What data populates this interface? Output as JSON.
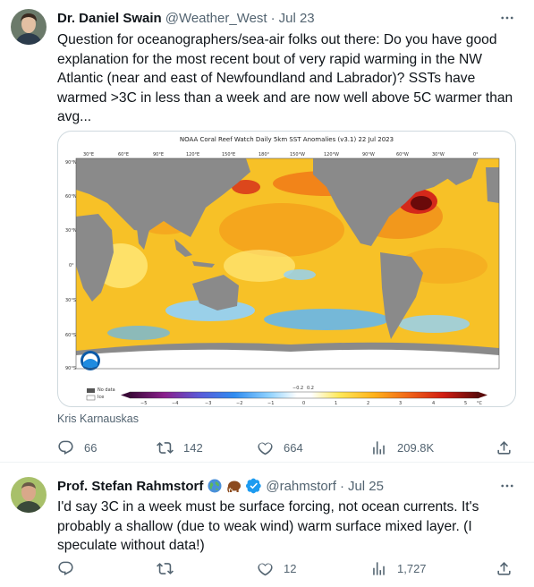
{
  "tweet1": {
    "author_name": "Dr. Daniel Swain",
    "handle": "@Weather_West",
    "separator": "·",
    "date": "Jul 23",
    "text": "Question for oceanographers/sea-air folks out there: Do you have good\nexplanation for the most recent bout of very rapid warming in the NW\nAtlantic (near and east of Newfoundland and Labrador)? SSTs have\nwarmed >3C in less than a week and are now well above 5C warmer than\navg...",
    "media": {
      "title": "NOAA Coral Reef Watch Daily 5km SST Anomalies  (v3.1)   22 Jul 2023",
      "lon_labels": [
        "30°E",
        "60°E",
        "90°E",
        "120°E",
        "150°E",
        "180°",
        "150°W",
        "120°W",
        "90°W",
        "60°W",
        "30°W",
        "0°"
      ],
      "lat_labels": [
        "90°N",
        "60°N",
        "30°N",
        "0°",
        "30°S",
        "60°S",
        "90°S"
      ],
      "legend_nodata": "No data",
      "legend_ice": "Ice",
      "scale_ticks": [
        "−5",
        "−4",
        "−3",
        "−2",
        "−1",
        "0",
        "1",
        "2",
        "3",
        "4",
        "5"
      ],
      "scale_minor": [
        "−0.2",
        "0.2"
      ],
      "scale_unit": "°C"
    },
    "credit": "Kris Karnauskas",
    "stats": {
      "replies": "66",
      "reposts": "142",
      "likes": "664",
      "views": "209.8K"
    }
  },
  "tweet2": {
    "author_name": "Prof. Stefan Rahmstorf",
    "handle": "@rahmstorf",
    "separator": "·",
    "date": "Jul 25",
    "text": "I'd say 3C in a week must be surface forcing, not ocean currents. It's\nprobably a shallow (due to weak wind) warm surface mixed layer. (I\nspeculate without data!)",
    "stats": {
      "likes": "12",
      "views": "1,727"
    }
  },
  "colors": {
    "text_primary": "#0f1419",
    "text_secondary": "#536471",
    "verified_blue": "#1d9bf0",
    "border": "#cfd9de"
  },
  "icons": [
    "reply-icon",
    "repost-icon",
    "like-icon",
    "views-icon",
    "share-icon",
    "more-icon",
    "verified-icon",
    "globe-emoji",
    "mammoth-emoji"
  ]
}
